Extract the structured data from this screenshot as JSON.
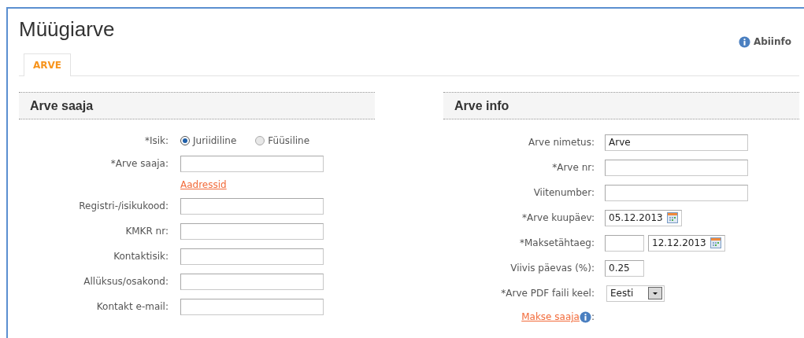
{
  "title": "Müügiarve",
  "help_link": "Abiinfo",
  "tabs": [
    {
      "label": "ARVE",
      "selected": true
    }
  ],
  "left_section": {
    "title": "Arve saaja",
    "rows": [
      {
        "kind": "radio",
        "label": "*Isik:",
        "options": [
          {
            "label": "Juriidiline",
            "selected": true
          },
          {
            "label": "Füüsiline",
            "selected": false
          }
        ]
      },
      {
        "kind": "text",
        "label": "*Arve saaja:"
      },
      {
        "kind": "link",
        "text": "Aadressid"
      },
      {
        "kind": "text",
        "label": "Registri-/isikukood:"
      },
      {
        "kind": "text",
        "label": "KMKR nr:"
      },
      {
        "kind": "text",
        "label": "Kontaktisik:"
      },
      {
        "kind": "text",
        "label": "Allüksus/osakond:"
      },
      {
        "kind": "text",
        "label": "Kontakt e-mail:"
      }
    ]
  },
  "right_section": {
    "title": "Arve info",
    "rows": [
      {
        "kind": "text",
        "label": "Arve nimetus:",
        "value": "Arve"
      },
      {
        "kind": "text",
        "label": "*Arve nr:"
      },
      {
        "kind": "text",
        "label": "Viitenumber:"
      },
      {
        "kind": "date",
        "label": "*Arve kuupäev:",
        "value": "05.12.2013"
      },
      {
        "kind": "due",
        "label": "*Maksetähtaeg:",
        "value": "12.12.2013"
      },
      {
        "kind": "short",
        "label": "Viivis päevas (%):",
        "value": "0.25"
      },
      {
        "kind": "select",
        "label": "*Arve PDF faili keel:",
        "value": "Eesti"
      },
      {
        "kind": "infolink",
        "text": "Makse saaja",
        "suffix": ":"
      }
    ]
  }
}
